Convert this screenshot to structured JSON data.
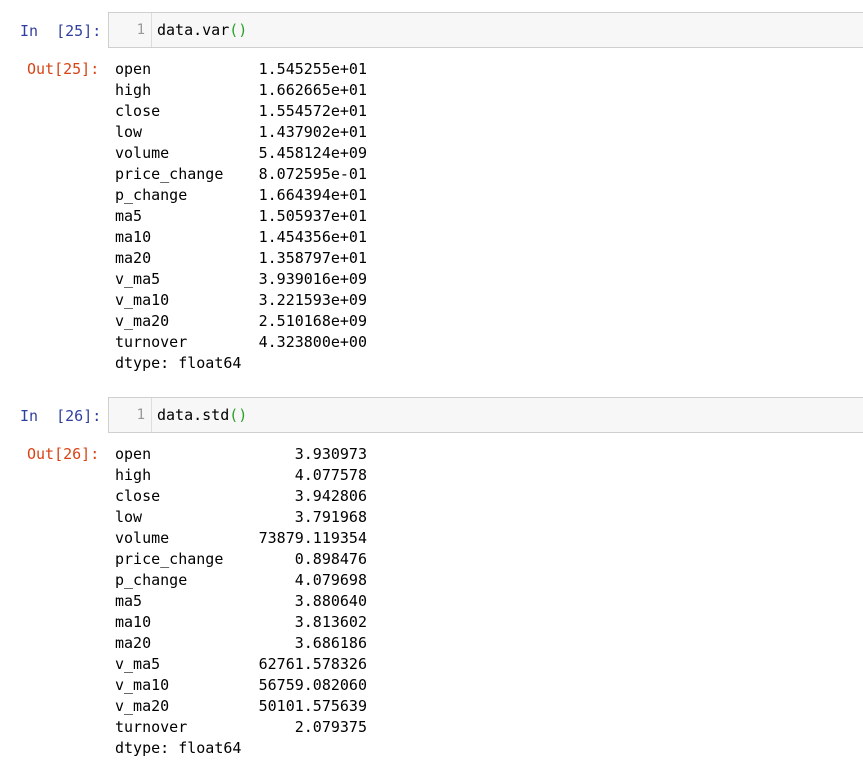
{
  "cells": [
    {
      "in_prompt": "In  [25]:",
      "line_number": "1",
      "code_prefix": "data.var",
      "code_parens": "()",
      "out_prompt": "Out[25]:",
      "rows": [
        {
          "name": "open",
          "value": "1.545255e+01"
        },
        {
          "name": "high",
          "value": "1.662665e+01"
        },
        {
          "name": "close",
          "value": "1.554572e+01"
        },
        {
          "name": "low",
          "value": "1.437902e+01"
        },
        {
          "name": "volume",
          "value": "5.458124e+09"
        },
        {
          "name": "price_change",
          "value": "8.072595e-01"
        },
        {
          "name": "p_change",
          "value": "1.664394e+01"
        },
        {
          "name": "ma5",
          "value": "1.505937e+01"
        },
        {
          "name": "ma10",
          "value": "1.454356e+01"
        },
        {
          "name": "ma20",
          "value": "1.358797e+01"
        },
        {
          "name": "v_ma5",
          "value": "3.939016e+09"
        },
        {
          "name": "v_ma10",
          "value": "3.221593e+09"
        },
        {
          "name": "v_ma20",
          "value": "2.510168e+09"
        },
        {
          "name": "turnover",
          "value": "4.323800e+00"
        }
      ],
      "dtype": "dtype: float64"
    },
    {
      "in_prompt": "In  [26]:",
      "line_number": "1",
      "code_prefix": "data.std",
      "code_parens": "()",
      "out_prompt": "Out[26]:",
      "rows": [
        {
          "name": "open",
          "value": "3.930973"
        },
        {
          "name": "high",
          "value": "4.077578"
        },
        {
          "name": "close",
          "value": "3.942806"
        },
        {
          "name": "low",
          "value": "3.791968"
        },
        {
          "name": "volume",
          "value": "73879.119354"
        },
        {
          "name": "price_change",
          "value": "0.898476"
        },
        {
          "name": "p_change",
          "value": "4.079698"
        },
        {
          "name": "ma5",
          "value": "3.880640"
        },
        {
          "name": "ma10",
          "value": "3.813602"
        },
        {
          "name": "ma20",
          "value": "3.686186"
        },
        {
          "name": "v_ma5",
          "value": "62761.578326"
        },
        {
          "name": "v_ma10",
          "value": "56759.082060"
        },
        {
          "name": "v_ma20",
          "value": "50101.575639"
        },
        {
          "name": "turnover",
          "value": "2.079375"
        }
      ],
      "dtype": "dtype: float64"
    }
  ]
}
